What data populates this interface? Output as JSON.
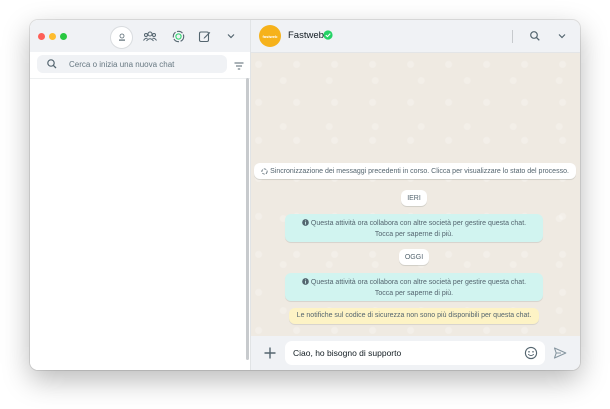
{
  "colors": {
    "chat_background": "#efeae2",
    "header_background": "#f0f2f5",
    "notice_background": "#d1f4f0",
    "security_notice_background": "#fdf3c5",
    "verified_badge": "#25d366",
    "contact_avatar": "#f6b21b"
  },
  "sidebar": {
    "search": {
      "placeholder": "Cerca o inizia una nuova chat",
      "value": ""
    },
    "icons": [
      "profile-avatar",
      "community-icon",
      "status-icon",
      "new-chat-icon",
      "chevron-down-icon",
      "search-icon",
      "filter-icon"
    ]
  },
  "chat": {
    "contact": {
      "name": "Fastweb",
      "avatar_text": "fastweb",
      "verified": true
    },
    "sync_message": "Sincronizzazione dei messaggi precedenti in corso. Clicca per visualizzare lo stato del processo.",
    "day_ieri": "IERI",
    "notice_1_line1": "Questa attività ora collabora con altre società per gestire questa chat.",
    "notice_1_line2": "Tocca per saperne di più.",
    "day_oggi": "OGGI",
    "notice_2_line1": "Questa attività ora collabora con altre società per gestire questa chat.",
    "notice_2_line2": "Tocca per saperne di più.",
    "security_notice": "Le notifiche sul codice di sicurezza non sono più disponibili per questa chat."
  },
  "composer": {
    "message_value": "Ciao, ho bisogno di supporto"
  }
}
